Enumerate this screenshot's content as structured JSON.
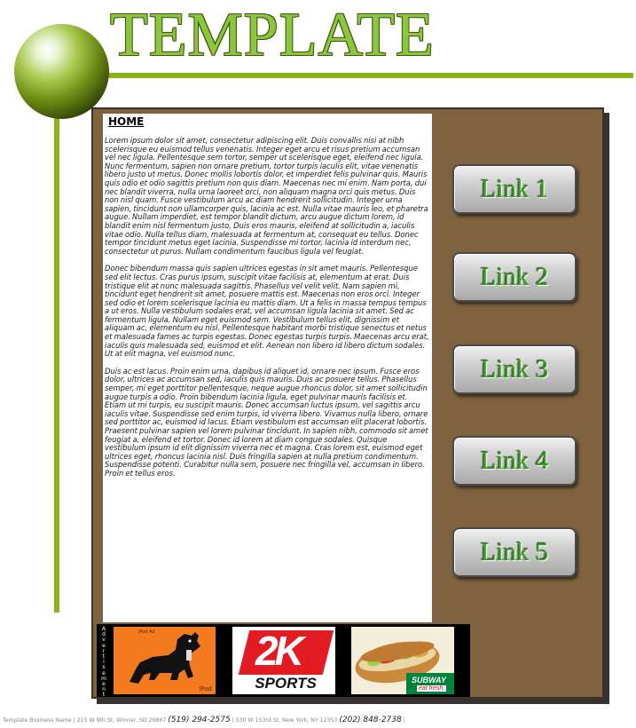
{
  "header": {
    "logo_text": "TEMPLATE"
  },
  "content": {
    "title": "HOME",
    "paragraphs": [
      "Lorem ipsum dolor sit amet, consectetur adipiscing elit. Duis convallis nisi at nibh scelerisque eu euismod tellus venenatis. Integer eget arcu et risus pretium accumsan vel nec ligula. Pellentesque sem tortor, semper ut scelerisque eget, eleifend nec ligula. Nunc fermentum, sapien non ornare pretium, tortor turpis iaculis elit, vitae venenatis libero justo ut metus. Donec mollis lobortis dolor, et imperdiet felis pulvinar quis. Mauris quis odio et odio sagittis pretium non quis diam. Maecenas nec mi enim. Nam porta, dui nec blandit viverra, nulla urna laoreet orci, non aliquam magna orci quis metus. Duis non nisl quam. Fusce vestibulum arcu ac diam hendrerit sollicitudin. Integer urna sapien, tincidunt non ullamcorper quis, lacinia ac est. Nulla vitae mauris leo, et pharetra augue. Nullam imperdiet, est tempor blandit dictum, arcu augue dictum lorem, id blandit enim nisl fermentum justo. Duis eros mauris, eleifend at sollicitudin a, iaculis vitae odio. Nulla tellus diam, malesuada at fermentum at, consequat eu tellus. Donec tempor tincidunt metus eget lacinia. Suspendisse mi tortor, lacinia id interdum nec, consectetur ut purus. Nullam condimentum faucibus ligula vel feugiat.",
      "Donec bibendum massa quis sapien ultrices egestas in sit amet mauris. Pellentesque sed elit lectus. Cras purus ipsum, suscipit vitae facilisis at, elementum at erat. Duis tristique elit at nunc malesuada sagittis. Phasellus vel velit velit. Nam sapien mi, tincidunt eget hendrerit sit amet, posuere mattis est. Maecenas non eros orci. Integer sed odio et lorem scelerisque lacinia eu mattis diam. Ut a felis in massa tempus tempus a ut eros. Nulla vestibulum sodales erat, vel accumsan ligula lacinia sit amet. Sed ac fermentum ligula. Nullam eget euismod sem. Vestibulum tellus elit, dignissim et aliquam ac, elementum eu nisl. Pellentesque habitant morbi tristique senectus et netus et malesuada fames ac turpis egestas. Donec egestas turpis turpis. Maecenas arcu erat, iaculis quis malesuada sed, euismod et elit. Aenean non libero id libero dictum sodales. Ut at elit magna, vel euismod nunc.",
      "Duis ac est lacus. Proin enim urna, dapibus id aliquet id, ornare nec ipsum. Fusce eros dolor, ultrices ac accumsan sed, iaculis quis mauris. Duis ac posuere tellus. Phasellus semper, mi eget porttitor pellentesque, neque augue rhoncus dolor, sit amet sollicitudin augue turpis a odio. Proin bibendum lacinia ligula, eget pulvinar mauris facilisis et. Etiam ut mi turpis, eu suscipit mauris. Donec accumsan luctus ipsum, vel sagittis arcu iaculis vitae. Suspendisse sed enim turpis, id viverra libero. Vivamus nulla libero, ornare sed porttitor ac, euismod id lacus. Etiam vestibulum est accumsan elit placerat lobortis. Praesent pulvinar sapien vel lorem pulvinar tincidunt. In sapien nibh, commodo sit amet feugiat a, eleifend et tortor. Donec id lorem at diam congue sodales. Quisque vestibulum ipsum id elit dignissim viverra nec et magna. Cras lorem est, euismod eget ultrices eget, rhoncus lacinia nisl. Duis fringilla sapien at nulla pretium condimentum. Suspendisse potenti. Curabitur nulla sem, posuere nec fringilla vel, accumsan in libero. Proin et tellus eros."
    ]
  },
  "nav": {
    "links": [
      "Link 1",
      "Link 2",
      "Link 3",
      "Link 4",
      "Link 5"
    ]
  },
  "ads": {
    "vertical_label": "Advertisement",
    "ad1_top": "iPod Ad",
    "ad1_label": "iPod",
    "ad2_logo": "2K",
    "ad2_label": "SPORTS",
    "ad3_brand": "SUBWAY",
    "ad3_tagline": "eat fresh."
  },
  "footer": {
    "business_name": "Template Business Name",
    "address1": "215 W 9th St. Winner, SD 26867",
    "phone1": "(519) 294-2575",
    "address2": "530 W 153rd St. New York, NY 12353",
    "phone2": "(202) 848-2738"
  },
  "colors": {
    "accent_green": "#8cb21a",
    "panel_brown": "#7f6340",
    "link_text_green": "#3a9a25",
    "subway_green": "#00843d"
  }
}
